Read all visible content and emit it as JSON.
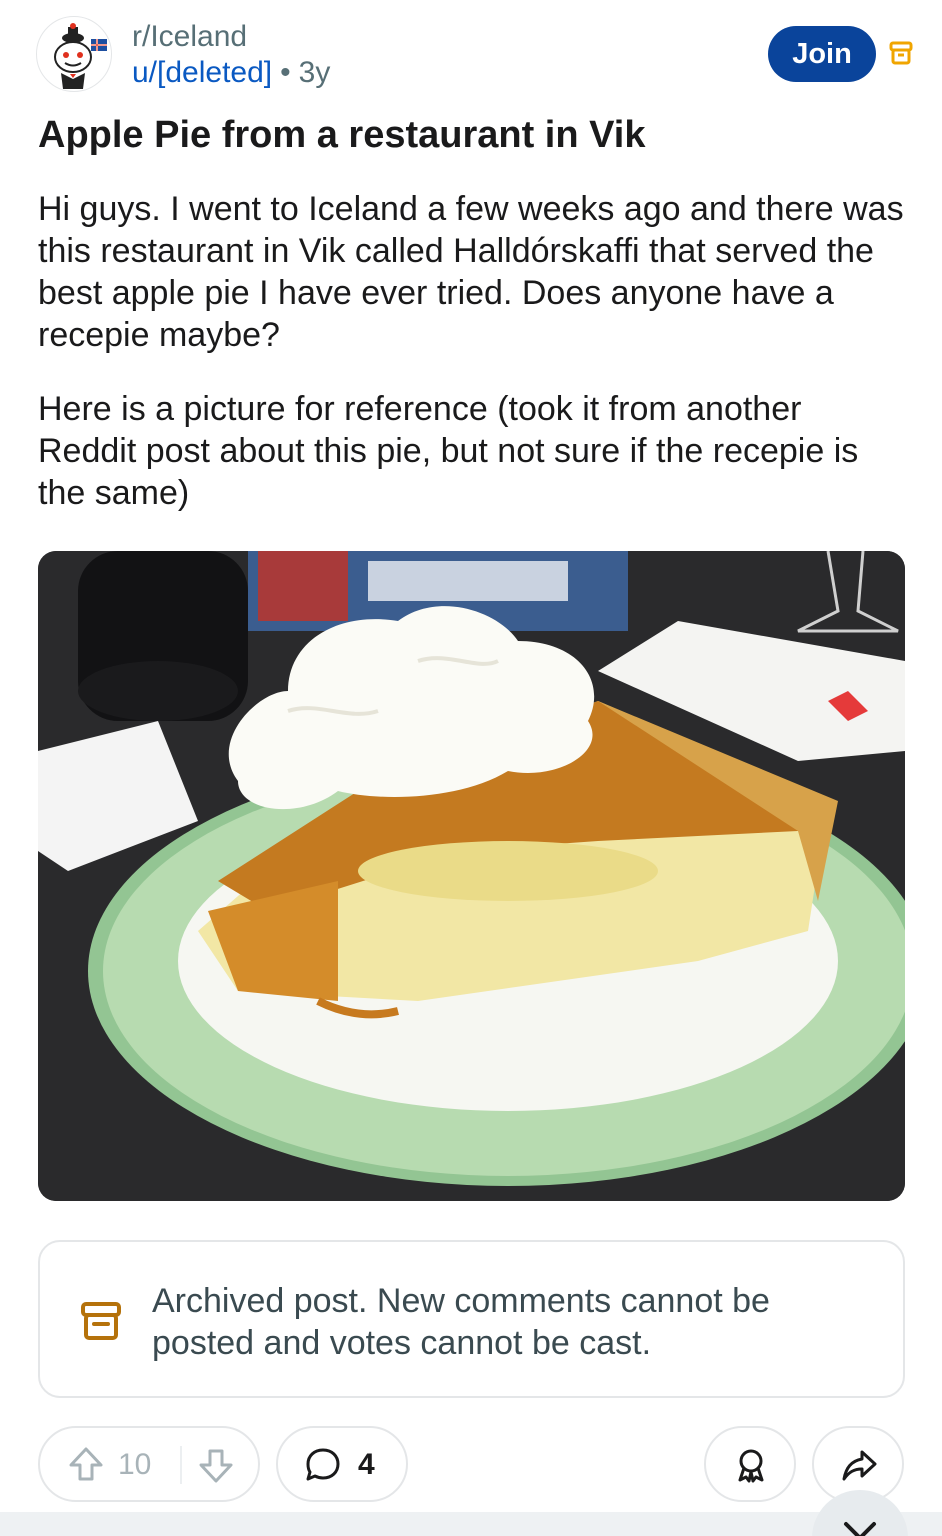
{
  "header": {
    "subreddit": "r/Iceland",
    "author": "u/[deleted]",
    "separator": "•",
    "age": "3y",
    "join_label": "Join",
    "accent_color": "#0a449b"
  },
  "post": {
    "title": "Apple Pie from a restaurant in Vik",
    "paragraphs": [
      "Hi guys.  I went to Iceland a few weeks ago and there was this restaurant in Vik called Halldórskaffi that served the best apple pie I have ever tried. Does anyone have a recepie maybe?",
      "Here is a picture for reference (took it from another Reddit post about this pie, but not sure if the recepie is the same)"
    ]
  },
  "archived_notice": {
    "text": "Archived post. New comments cannot be posted and votes cannot be cast.",
    "icon": "archive-icon",
    "icon_color": "#b5720b"
  },
  "actions": {
    "vote_count": "10",
    "comment_count": "4",
    "icons": [
      "upvote-icon",
      "downvote-icon",
      "comment-icon",
      "award-icon",
      "share-icon"
    ]
  }
}
